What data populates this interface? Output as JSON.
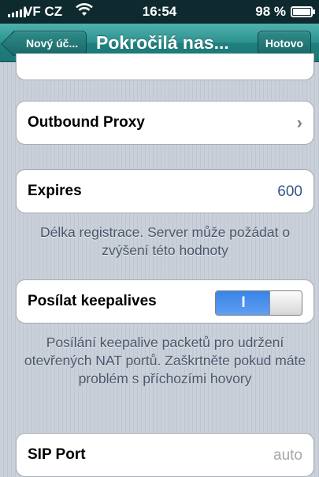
{
  "status_bar": {
    "carrier": "VF CZ",
    "time": "16:54",
    "battery": "98 %",
    "battery_level": 0.98
  },
  "nav": {
    "back_label": "Nový úč...",
    "title": "Pokročilá nas...",
    "done_label": "Hotovo"
  },
  "cells": {
    "outbound_proxy": {
      "label": "Outbound Proxy"
    },
    "expires": {
      "label": "Expires",
      "value": "600",
      "footer": "Délka registrace. Server může požádat o zvýšení této hodnoty"
    },
    "keepalives": {
      "label": "Posílat keepalives",
      "toggle_on_text": "I",
      "toggle_state": true,
      "footer": "Posílání keepalive packetů pro udržení otevřených NAT portů. Zaškrtněte pokud máte problém s příchozími hovory"
    },
    "sip_port": {
      "label": "SIP Port",
      "placeholder": "auto"
    }
  }
}
